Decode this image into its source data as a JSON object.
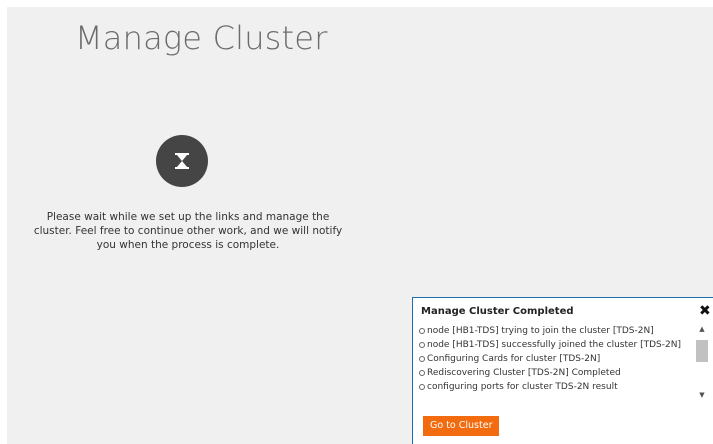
{
  "main": {
    "title": "Manage Cluster",
    "status_icon": "hourglass-icon",
    "wait_message": "Please wait while we set up the links and manage the cluster. Feel free to continue other work, and we will notify you when the process is complete."
  },
  "notification": {
    "title": "Manage Cluster Completed",
    "close_glyph": "✖",
    "log_items": [
      "node [HB1-TDS] trying to join the cluster [TDS-2N]",
      "node [HB1-TDS] successfully joined the cluster [TDS-2N]",
      "Configuring Cards for cluster [TDS-2N]",
      "Rediscovering Cluster [TDS-2N] Completed",
      "configuring ports for cluster TDS-2N result"
    ],
    "go_button_label": "Go to Cluster"
  },
  "colors": {
    "background": "#f0f0f0",
    "icon_circle": "#454545",
    "panel_border": "#1f6fb5",
    "button": "#f26b0f"
  }
}
